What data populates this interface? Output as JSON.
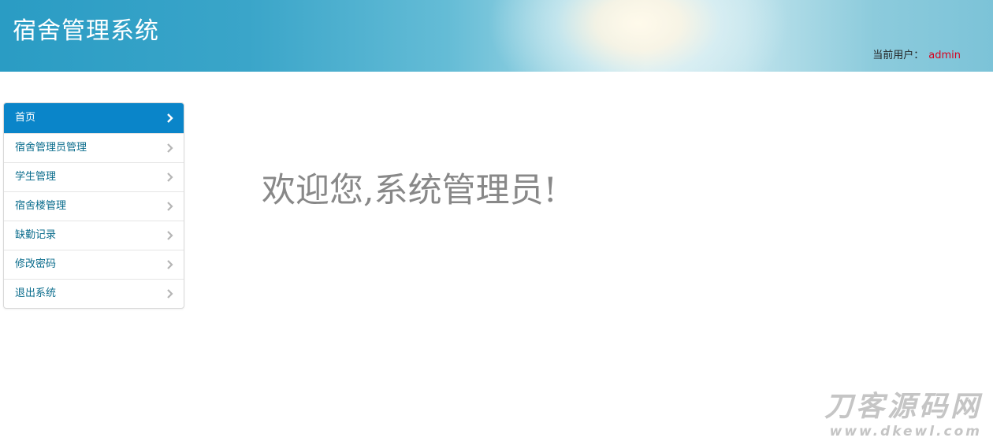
{
  "header": {
    "title": "宿舍管理系统",
    "user_label": "当前用户：",
    "user_name": "admin"
  },
  "sidebar": {
    "items": [
      {
        "label": "首页",
        "active": true
      },
      {
        "label": "宿舍管理员管理",
        "active": false
      },
      {
        "label": "学生管理",
        "active": false
      },
      {
        "label": "宿舍楼管理",
        "active": false
      },
      {
        "label": "缺勤记录",
        "active": false
      },
      {
        "label": "修改密码",
        "active": false
      },
      {
        "label": "退出系统",
        "active": false
      }
    ]
  },
  "main": {
    "welcome": "欢迎您,系统管理员!"
  },
  "watermark": {
    "text_cn": "刀客源码网",
    "url": "www.dkewl.com"
  },
  "colors": {
    "accent": "#0a85c9",
    "link": "#0a6c8c",
    "user_name": "#d8001e"
  }
}
